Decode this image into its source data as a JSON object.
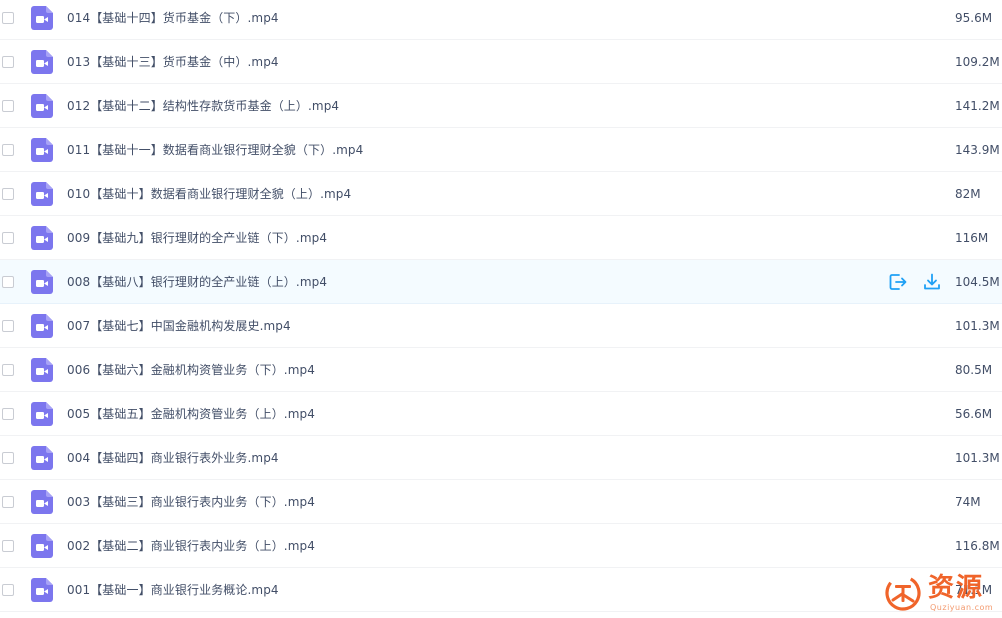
{
  "files": [
    {
      "name": "014【基础十四】货币基金（下）.mp4",
      "size": "95.6M"
    },
    {
      "name": "013【基础十三】货币基金（中）.mp4",
      "size": "109.2M"
    },
    {
      "name": "012【基础十二】结构性存款货币基金（上）.mp4",
      "size": "141.2M"
    },
    {
      "name": "011【基础十一】数据看商业银行理财全貌（下）.mp4",
      "size": "143.9M"
    },
    {
      "name": "010【基础十】数据看商业银行理财全貌（上）.mp4",
      "size": "82M"
    },
    {
      "name": "009【基础九】银行理财的全产业链（下）.mp4",
      "size": "116M"
    },
    {
      "name": "008【基础八】银行理财的全产业链（上）.mp4",
      "size": "104.5M"
    },
    {
      "name": "007【基础七】中国金融机构发展史.mp4",
      "size": "101.3M"
    },
    {
      "name": "006【基础六】金融机构资管业务（下）.mp4",
      "size": "80.5M"
    },
    {
      "name": "005【基础五】金融机构资管业务（上）.mp4",
      "size": "56.6M"
    },
    {
      "name": "004【基础四】商业银行表外业务.mp4",
      "size": "101.3M"
    },
    {
      "name": "003【基础三】商业银行表内业务（下）.mp4",
      "size": "74M"
    },
    {
      "name": "002【基础二】商业银行表内业务（上）.mp4",
      "size": "116.8M"
    },
    {
      "name": "001【基础一】商业银行业务概论.mp4",
      "size": "71.1M"
    }
  ],
  "hovered_row": 6,
  "row_actions": [
    "share-icon",
    "download-icon"
  ],
  "file_icon": "video-file-icon",
  "colors": {
    "file_icon": "#7c76ee",
    "action": "#1ea0f5",
    "hover_bg": "#f4fbff",
    "text": "#424e67",
    "watermark": "#f0642a"
  },
  "watermark": {
    "title": "资源",
    "subtitle": "Quziyuan.com",
    "icon": "watermark-logo-icon"
  }
}
